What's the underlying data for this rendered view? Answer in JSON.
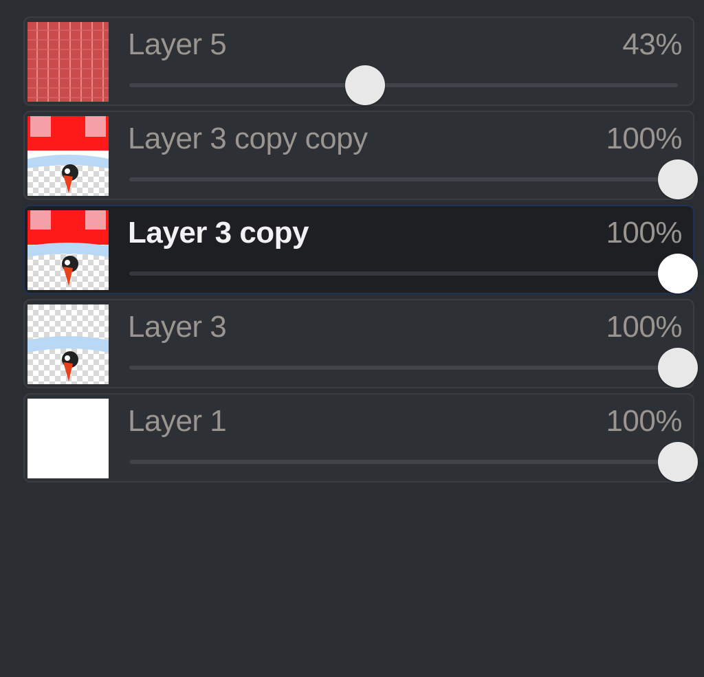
{
  "layers_panel": {
    "layers": [
      {
        "name": "Layer 5",
        "opacity_label": "43%",
        "opacity": 0.43,
        "selected": false,
        "thumbnail": "red-stripes-thumbnail"
      },
      {
        "name": "Layer 3 copy copy",
        "opacity_label": "100%",
        "opacity": 1.0,
        "selected": false,
        "thumbnail": "character-red-band-thumbnail"
      },
      {
        "name": "Layer 3 copy",
        "opacity_label": "100%",
        "opacity": 1.0,
        "selected": true,
        "thumbnail": "character-red-top-thumbnail"
      },
      {
        "name": "Layer 3",
        "opacity_label": "100%",
        "opacity": 1.0,
        "selected": false,
        "thumbnail": "character-transparent-thumbnail"
      },
      {
        "name": "Layer 1",
        "opacity_label": "100%",
        "opacity": 1.0,
        "selected": false,
        "thumbnail": "white-fill-thumbnail"
      }
    ],
    "colors": {
      "panel_background": "#2a2d31",
      "row_background": "#2d3034",
      "selected_row_background": "#1d1f22",
      "selected_border": "#1f3258",
      "text": "#9a9590",
      "selected_text": "#f2f2f2",
      "knob": "#e8e8e8"
    }
  }
}
